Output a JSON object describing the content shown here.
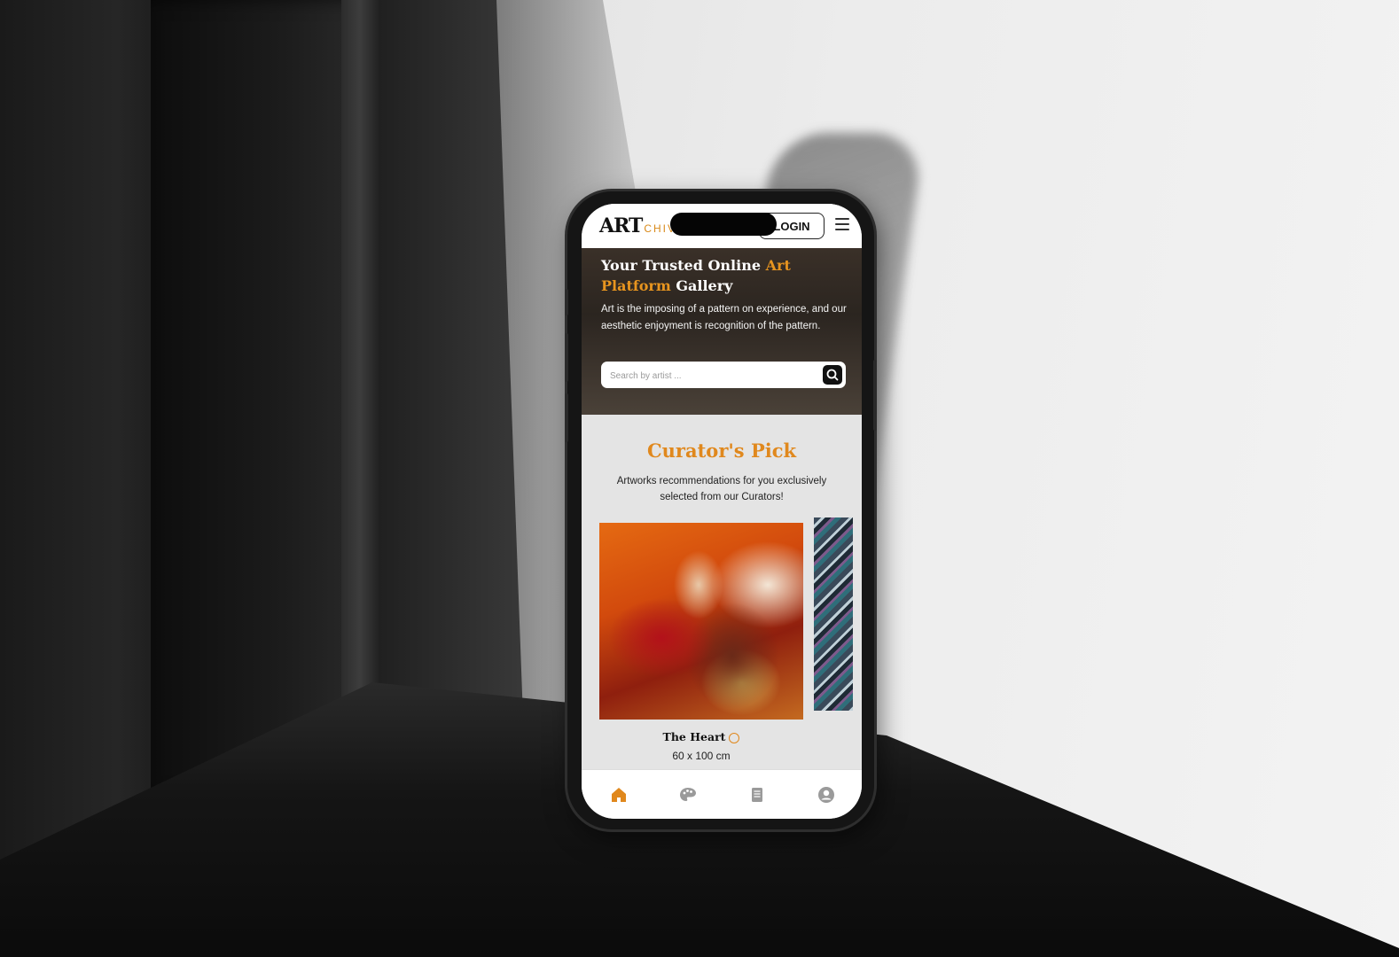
{
  "app": {
    "logo_main": "ART",
    "logo_sub": "CHIV",
    "login_label": "LOGIN"
  },
  "hero": {
    "title_part1": "Your Trusted Online ",
    "title_accent": "Art Platform",
    "title_part2": " Gallery",
    "description": "Art is the imposing of a pattern on experience, and our aesthetic enjoyment is recognition of the pattern.",
    "search_placeholder": "Search by artist ..."
  },
  "curator": {
    "title": "Curator's Pick",
    "subtitle": "Artworks recommendations for you exclusively selected from our Curators!",
    "artwork": {
      "name": "The Heart",
      "size": "60 x 100 cm"
    }
  },
  "nav": {
    "items": [
      "home-icon",
      "palette-icon",
      "document-icon",
      "profile-icon"
    ],
    "active_color": "#e0881d",
    "inactive_color": "#9a9a9a"
  },
  "colors": {
    "accent": "#e0881d",
    "hero_bg": "#2b2520",
    "section_bg": "#e4e4e4"
  }
}
